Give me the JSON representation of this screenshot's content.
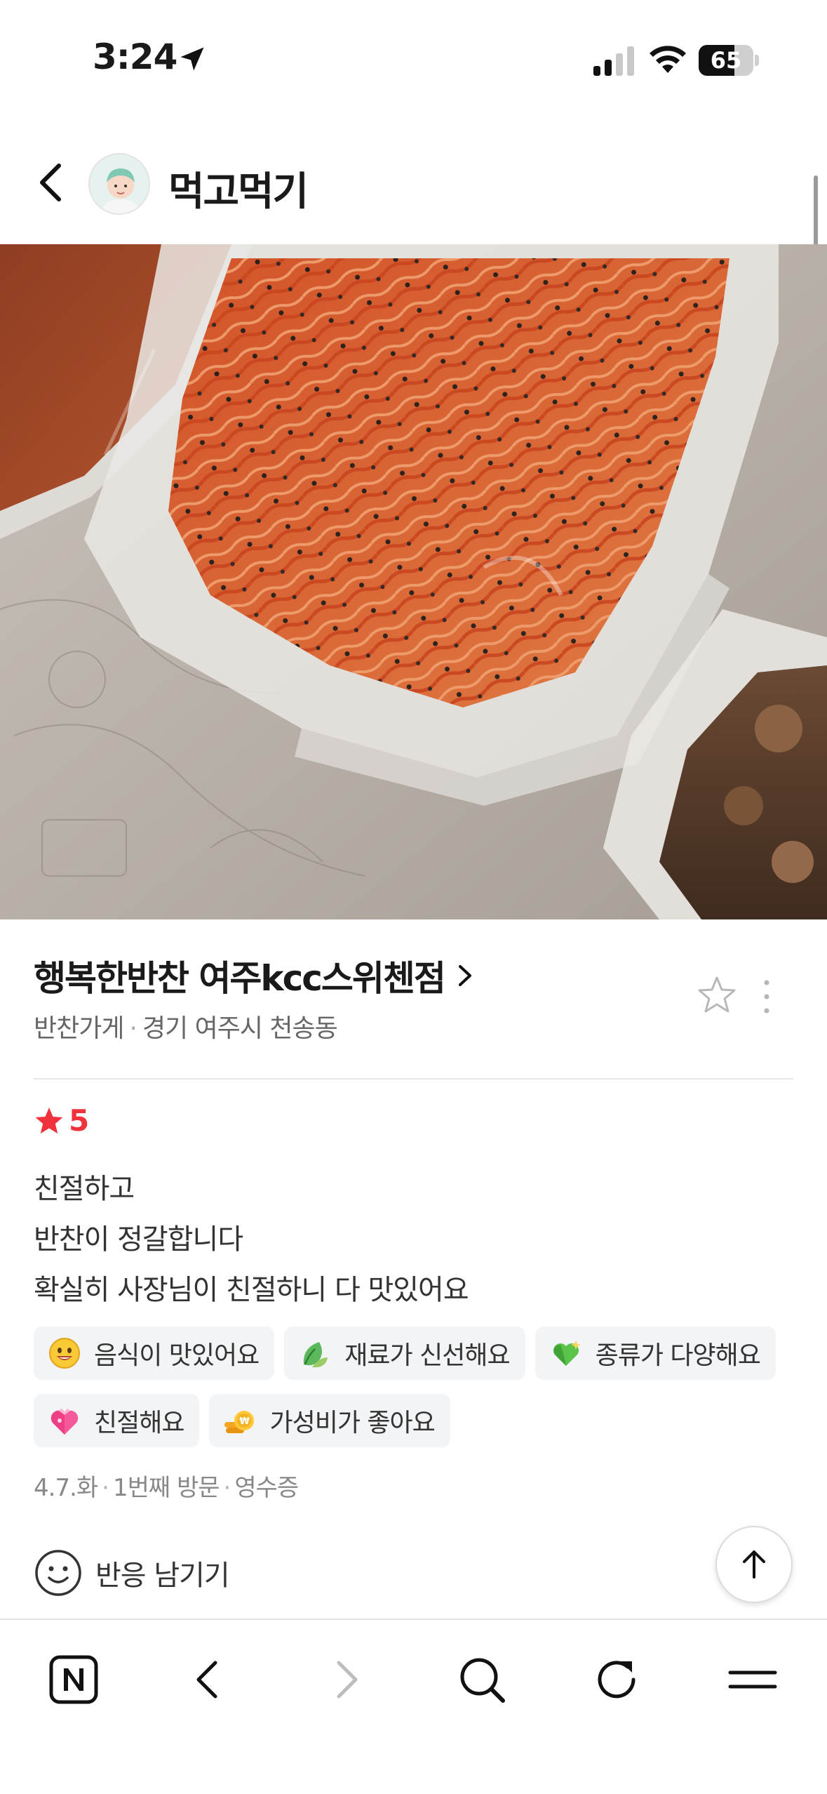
{
  "status_bar": {
    "time": "3:24",
    "battery_percent": 65,
    "battery_label": "65",
    "icons": [
      "location-arrow-icon",
      "cellular-signal-icon",
      "wifi-icon",
      "battery-icon"
    ]
  },
  "header": {
    "profile_name": "먹고먹기",
    "back_icon": "chevron-left-icon",
    "avatar_icon": "user-avatar"
  },
  "photo": {
    "subject": "side dishes in plastic containers"
  },
  "store": {
    "name": "행복한반찬 여주kcc스위첸점",
    "category": "반찬가게",
    "separator": "·",
    "location": "경기 여주시 천송동"
  },
  "review": {
    "rating": "5",
    "lines": [
      "친절하고",
      "반찬이 정갈합니다",
      "확실히 사장님이 친절하니 다 맛있어요"
    ],
    "tags_row1": [
      {
        "label": "음식이 맛있어요",
        "icon": "smiling-face-icon"
      },
      {
        "label": "재료가 신선해요",
        "icon": "leaf-icon"
      },
      {
        "label": "종류가 다양해요",
        "icon": "sparkling-heart-icon"
      }
    ],
    "tags_row2": [
      {
        "label": "친절해요",
        "icon": "heart-with-ribbon-icon"
      },
      {
        "label": "가성비가 좋아요",
        "icon": "coin-icon"
      }
    ],
    "visit": {
      "date": "4.7.화",
      "count": "1번째 방문",
      "proof": "영수증",
      "separator": "·"
    },
    "react_label": "반응 남기기"
  },
  "toolbar": {
    "items": [
      "naver-home-icon",
      "back-icon",
      "forward-icon",
      "search-icon",
      "reload-icon",
      "menu-icon"
    ]
  },
  "colors": {
    "rating_red": "#f0323c",
    "tag_bg": "#f3f4f6",
    "meta_gray": "#888888"
  }
}
